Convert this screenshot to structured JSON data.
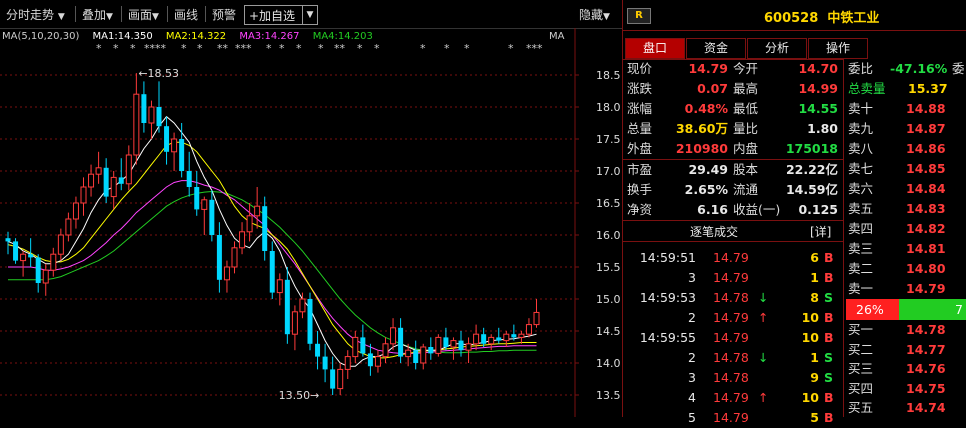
{
  "toolbar": {
    "items": [
      "分时走势",
      "叠加",
      "画面",
      "画线",
      "预警"
    ],
    "add_label": "+加自选",
    "hide_label": "隐藏"
  },
  "ma": {
    "header": "MA(5,10,20,30)",
    "ma1": "MA1:14.350",
    "ma2": "MA2:14.322",
    "ma3": "MA3:14.267",
    "ma4": "MA4:14.203",
    "right_tag": "MA",
    "colors": {
      "ma1": "#ffffff",
      "ma2": "#ffff00",
      "ma3": "#ff44ff",
      "ma4": "#22cc22"
    }
  },
  "chart_data": {
    "type": "candlestick",
    "price_axis": [
      "18.5",
      "18.0",
      "17.5",
      "17.0",
      "16.5",
      "16.0",
      "15.5",
      "15.0",
      "14.5",
      "14.0",
      "13.5"
    ],
    "ylim": [
      13.45,
      18.75
    ],
    "high_label": "18.53",
    "low_label": "13.50",
    "candles": [
      [
        15.95,
        16.05,
        15.7,
        15.9
      ],
      [
        15.9,
        15.95,
        15.55,
        15.6
      ],
      [
        15.6,
        15.75,
        15.35,
        15.7
      ],
      [
        15.7,
        15.95,
        15.5,
        15.65
      ],
      [
        15.65,
        15.7,
        15.1,
        15.25
      ],
      [
        15.25,
        15.55,
        15.05,
        15.45
      ],
      [
        15.45,
        15.8,
        15.35,
        15.7
      ],
      [
        15.7,
        16.1,
        15.6,
        16.0
      ],
      [
        16.0,
        16.35,
        15.9,
        16.25
      ],
      [
        16.25,
        16.6,
        16.1,
        16.5
      ],
      [
        16.5,
        16.9,
        16.3,
        16.75
      ],
      [
        16.75,
        17.1,
        16.6,
        16.95
      ],
      [
        16.95,
        17.3,
        16.8,
        17.05
      ],
      [
        17.05,
        17.2,
        16.5,
        16.6
      ],
      [
        16.6,
        17.0,
        16.4,
        16.9
      ],
      [
        16.9,
        17.2,
        16.7,
        16.8
      ],
      [
        16.8,
        17.4,
        16.7,
        17.25
      ],
      [
        17.25,
        18.53,
        17.1,
        18.2
      ],
      [
        18.2,
        18.4,
        17.6,
        17.75
      ],
      [
        17.75,
        18.1,
        17.5,
        18.0
      ],
      [
        18.0,
        18.4,
        17.6,
        17.7
      ],
      [
        17.7,
        17.85,
        17.1,
        17.3
      ],
      [
        17.3,
        17.6,
        17.0,
        17.5
      ],
      [
        17.5,
        17.75,
        16.9,
        17.0
      ],
      [
        17.0,
        17.3,
        16.6,
        16.75
      ],
      [
        16.75,
        17.0,
        16.3,
        16.4
      ],
      [
        16.4,
        16.6,
        16.0,
        16.55
      ],
      [
        16.55,
        16.7,
        15.9,
        16.0
      ],
      [
        16.0,
        16.2,
        15.1,
        15.3
      ],
      [
        15.3,
        15.6,
        15.1,
        15.5
      ],
      [
        15.5,
        15.9,
        15.4,
        15.8
      ],
      [
        15.8,
        16.2,
        15.7,
        16.05
      ],
      [
        16.05,
        16.5,
        15.9,
        16.3
      ],
      [
        16.3,
        16.75,
        16.1,
        16.45
      ],
      [
        16.45,
        16.6,
        15.6,
        15.75
      ],
      [
        15.75,
        15.9,
        15.0,
        15.1
      ],
      [
        15.1,
        15.4,
        14.9,
        15.3
      ],
      [
        15.3,
        15.5,
        14.3,
        14.45
      ],
      [
        14.45,
        14.9,
        14.2,
        14.8
      ],
      [
        14.8,
        15.1,
        14.7,
        15.0
      ],
      [
        15.0,
        15.1,
        14.2,
        14.3
      ],
      [
        14.3,
        14.5,
        13.9,
        14.1
      ],
      [
        14.1,
        14.3,
        13.7,
        13.9
      ],
      [
        13.9,
        14.1,
        13.5,
        13.6
      ],
      [
        13.6,
        14.0,
        13.5,
        13.9
      ],
      [
        13.9,
        14.2,
        13.75,
        14.1
      ],
      [
        14.1,
        14.5,
        14.0,
        14.4
      ],
      [
        14.4,
        14.6,
        14.1,
        14.15
      ],
      [
        14.15,
        14.3,
        13.8,
        13.95
      ],
      [
        13.95,
        14.2,
        13.85,
        14.1
      ],
      [
        14.1,
        14.4,
        14.0,
        14.3
      ],
      [
        14.3,
        14.7,
        14.2,
        14.55
      ],
      [
        14.55,
        14.7,
        14.0,
        14.1
      ],
      [
        14.1,
        14.3,
        13.95,
        14.2
      ],
      [
        14.2,
        14.35,
        13.9,
        14.0
      ],
      [
        14.0,
        14.3,
        13.9,
        14.25
      ],
      [
        14.25,
        14.4,
        14.05,
        14.15
      ],
      [
        14.15,
        14.45,
        14.1,
        14.4
      ],
      [
        14.4,
        14.55,
        14.2,
        14.25
      ],
      [
        14.25,
        14.4,
        14.05,
        14.35
      ],
      [
        14.35,
        14.5,
        14.1,
        14.2
      ],
      [
        14.2,
        14.4,
        14.0,
        14.3
      ],
      [
        14.3,
        14.6,
        14.2,
        14.45
      ],
      [
        14.45,
        14.55,
        14.25,
        14.3
      ],
      [
        14.3,
        14.45,
        14.2,
        14.4
      ],
      [
        14.4,
        14.55,
        14.3,
        14.35
      ],
      [
        14.35,
        14.5,
        14.25,
        14.45
      ],
      [
        14.45,
        14.6,
        14.35,
        14.4
      ],
      [
        14.4,
        14.5,
        14.3,
        14.45
      ],
      [
        14.45,
        14.7,
        14.4,
        14.6
      ],
      [
        14.6,
        15.0,
        14.55,
        14.79
      ]
    ],
    "ma1": [
      15.9,
      15.85,
      15.75,
      15.7,
      15.62,
      15.55,
      15.55,
      15.6,
      15.7,
      15.9,
      16.1,
      16.35,
      16.55,
      16.7,
      16.75,
      16.85,
      16.95,
      17.15,
      17.35,
      17.5,
      17.7,
      17.85,
      17.75,
      17.6,
      17.45,
      17.15,
      16.9,
      16.7,
      16.4,
      16.15,
      15.95,
      15.85,
      15.8,
      15.95,
      16.05,
      15.95,
      15.75,
      15.45,
      15.2,
      15.0,
      14.85,
      14.6,
      14.35,
      14.15,
      14.0,
      13.95,
      13.95,
      14.05,
      14.1,
      14.1,
      14.15,
      14.25,
      14.3,
      14.25,
      14.2,
      14.2,
      14.2,
      14.2,
      14.25,
      14.3,
      14.3,
      14.28,
      14.3,
      14.32,
      14.35,
      14.36,
      14.37,
      14.38,
      14.4,
      14.42,
      14.45
    ],
    "ma2": [
      15.85,
      15.82,
      15.78,
      15.72,
      15.65,
      15.6,
      15.58,
      15.58,
      15.62,
      15.7,
      15.8,
      15.95,
      16.1,
      16.25,
      16.4,
      16.55,
      16.68,
      16.8,
      16.95,
      17.1,
      17.25,
      17.4,
      17.45,
      17.45,
      17.4,
      17.3,
      17.15,
      17.0,
      16.85,
      16.65,
      16.45,
      16.3,
      16.2,
      16.15,
      16.1,
      16.0,
      15.9,
      15.78,
      15.6,
      15.4,
      15.2,
      15.0,
      14.8,
      14.6,
      14.45,
      14.3,
      14.2,
      14.15,
      14.1,
      14.08,
      14.08,
      14.1,
      14.13,
      14.15,
      14.17,
      14.18,
      14.2,
      14.2,
      14.22,
      14.23,
      14.25,
      14.26,
      14.27,
      14.28,
      14.29,
      14.3,
      14.3,
      14.31,
      14.32,
      14.32,
      14.32
    ],
    "ma3": [
      15.5,
      15.5,
      15.5,
      15.5,
      15.48,
      15.45,
      15.45,
      15.47,
      15.5,
      15.55,
      15.6,
      15.68,
      15.78,
      15.88,
      16.0,
      16.1,
      16.22,
      16.35,
      16.45,
      16.55,
      16.65,
      16.75,
      16.82,
      16.85,
      16.85,
      16.82,
      16.78,
      16.75,
      16.7,
      16.62,
      16.55,
      16.45,
      16.35,
      16.25,
      16.15,
      16.0,
      15.85,
      15.7,
      15.55,
      15.38,
      15.2,
      15.02,
      14.85,
      14.7,
      14.57,
      14.45,
      14.36,
      14.3,
      14.25,
      14.2,
      14.18,
      14.16,
      14.15,
      14.15,
      14.15,
      14.16,
      14.17,
      14.18,
      14.19,
      14.2,
      14.21,
      14.22,
      14.23,
      14.24,
      14.25,
      14.26,
      14.26,
      14.27,
      14.27,
      14.27,
      14.27
    ],
    "ma4": [
      15.3,
      15.3,
      15.3,
      15.3,
      15.3,
      15.3,
      15.32,
      15.35,
      15.4,
      15.45,
      15.5,
      15.55,
      15.6,
      15.67,
      15.75,
      15.85,
      15.95,
      16.05,
      16.15,
      16.25,
      16.35,
      16.45,
      16.52,
      16.58,
      16.62,
      16.65,
      16.67,
      16.68,
      16.67,
      16.65,
      16.6,
      16.55,
      16.48,
      16.4,
      16.32,
      16.22,
      16.12,
      16.0,
      15.88,
      15.75,
      15.6,
      15.45,
      15.3,
      15.15,
      15.0,
      14.87,
      14.75,
      14.65,
      14.55,
      14.47,
      14.4,
      14.35,
      14.3,
      14.26,
      14.22,
      14.2,
      14.18,
      14.17,
      14.16,
      14.16,
      14.16,
      14.17,
      14.17,
      14.18,
      14.18,
      14.19,
      14.19,
      14.2,
      14.2,
      14.2,
      14.2
    ]
  },
  "panel": {
    "badge": "R",
    "code": "600528",
    "name": "中铁工业",
    "tabs": [
      "盘口",
      "资金",
      "分析",
      "操作"
    ],
    "quote": [
      {
        "l1": "现价",
        "v1": "14.79",
        "c1": "red",
        "l2": "今开",
        "v2": "14.70",
        "c2": "red"
      },
      {
        "l1": "涨跌",
        "v1": "0.07",
        "c1": "red",
        "l2": "最高",
        "v2": "14.99",
        "c2": "red"
      },
      {
        "l1": "涨幅",
        "v1": "0.48%",
        "c1": "red",
        "l2": "最低",
        "v2": "14.55",
        "c2": "green"
      },
      {
        "l1": "总量",
        "v1": "38.60万",
        "c1": "yellow",
        "l2": "量比",
        "v2": "1.80",
        "c2": "white"
      },
      {
        "l1": "外盘",
        "v1": "210980",
        "c1": "red",
        "l2": "内盘",
        "v2": "175018",
        "c2": "green"
      },
      {
        "l1": "市盈",
        "v1": "29.49",
        "c1": "white",
        "l2": "股本",
        "v2": "22.22亿",
        "c2": "white"
      },
      {
        "l1": "换手",
        "v1": "2.65%",
        "c1": "white",
        "l2": "流通",
        "v2": "14.59亿",
        "c2": "white"
      },
      {
        "l1": "净资",
        "v1": "6.16",
        "c1": "white",
        "l2": "收益(一)",
        "v2": "0.125",
        "c2": "white"
      }
    ],
    "ticks_title": "逐笔成交",
    "ticks_detail": "[详]",
    "ticks": [
      {
        "t": "14:59:51",
        "p": "14.79",
        "arrow": "",
        "v": "6",
        "d": "B"
      },
      {
        "t": "3",
        "p": "14.79",
        "arrow": "",
        "v": "1",
        "d": "B"
      },
      {
        "t": "14:59:53",
        "p": "14.78",
        "arrow": "↓",
        "v": "8",
        "d": "S"
      },
      {
        "t": "2",
        "p": "14.79",
        "arrow": "↑",
        "v": "10",
        "d": "B"
      },
      {
        "t": "14:59:55",
        "p": "14.79",
        "arrow": "",
        "v": "10",
        "d": "B"
      },
      {
        "t": "2",
        "p": "14.78",
        "arrow": "↓",
        "v": "1",
        "d": "S"
      },
      {
        "t": "3",
        "p": "14.78",
        "arrow": "",
        "v": "9",
        "d": "S"
      },
      {
        "t": "4",
        "p": "14.79",
        "arrow": "↑",
        "v": "10",
        "d": "B"
      },
      {
        "t": "5",
        "p": "14.79",
        "arrow": "",
        "v": "5",
        "d": "B"
      }
    ],
    "book": {
      "ratio_label": "委比",
      "ratio_value": "-47.16%",
      "ratio_trail": "委",
      "total_sell_label": "总卖量",
      "total_sell_value": "15.37",
      "sells": [
        {
          "l": "卖十",
          "p": "14.88"
        },
        {
          "l": "卖九",
          "p": "14.87"
        },
        {
          "l": "卖八",
          "p": "14.86"
        },
        {
          "l": "卖七",
          "p": "14.85"
        },
        {
          "l": "卖六",
          "p": "14.84"
        },
        {
          "l": "卖五",
          "p": "14.83"
        },
        {
          "l": "卖四",
          "p": "14.82"
        },
        {
          "l": "卖三",
          "p": "14.81"
        },
        {
          "l": "卖二",
          "p": "14.80"
        },
        {
          "l": "卖一",
          "p": "14.79"
        }
      ],
      "bar_left": "26%",
      "bar_right": "7",
      "buys": [
        {
          "l": "买一",
          "p": "14.78"
        },
        {
          "l": "买二",
          "p": "14.77"
        },
        {
          "l": "买三",
          "p": "14.76"
        },
        {
          "l": "买四",
          "p": "14.75"
        },
        {
          "l": "买五",
          "p": "14.74"
        }
      ]
    }
  }
}
